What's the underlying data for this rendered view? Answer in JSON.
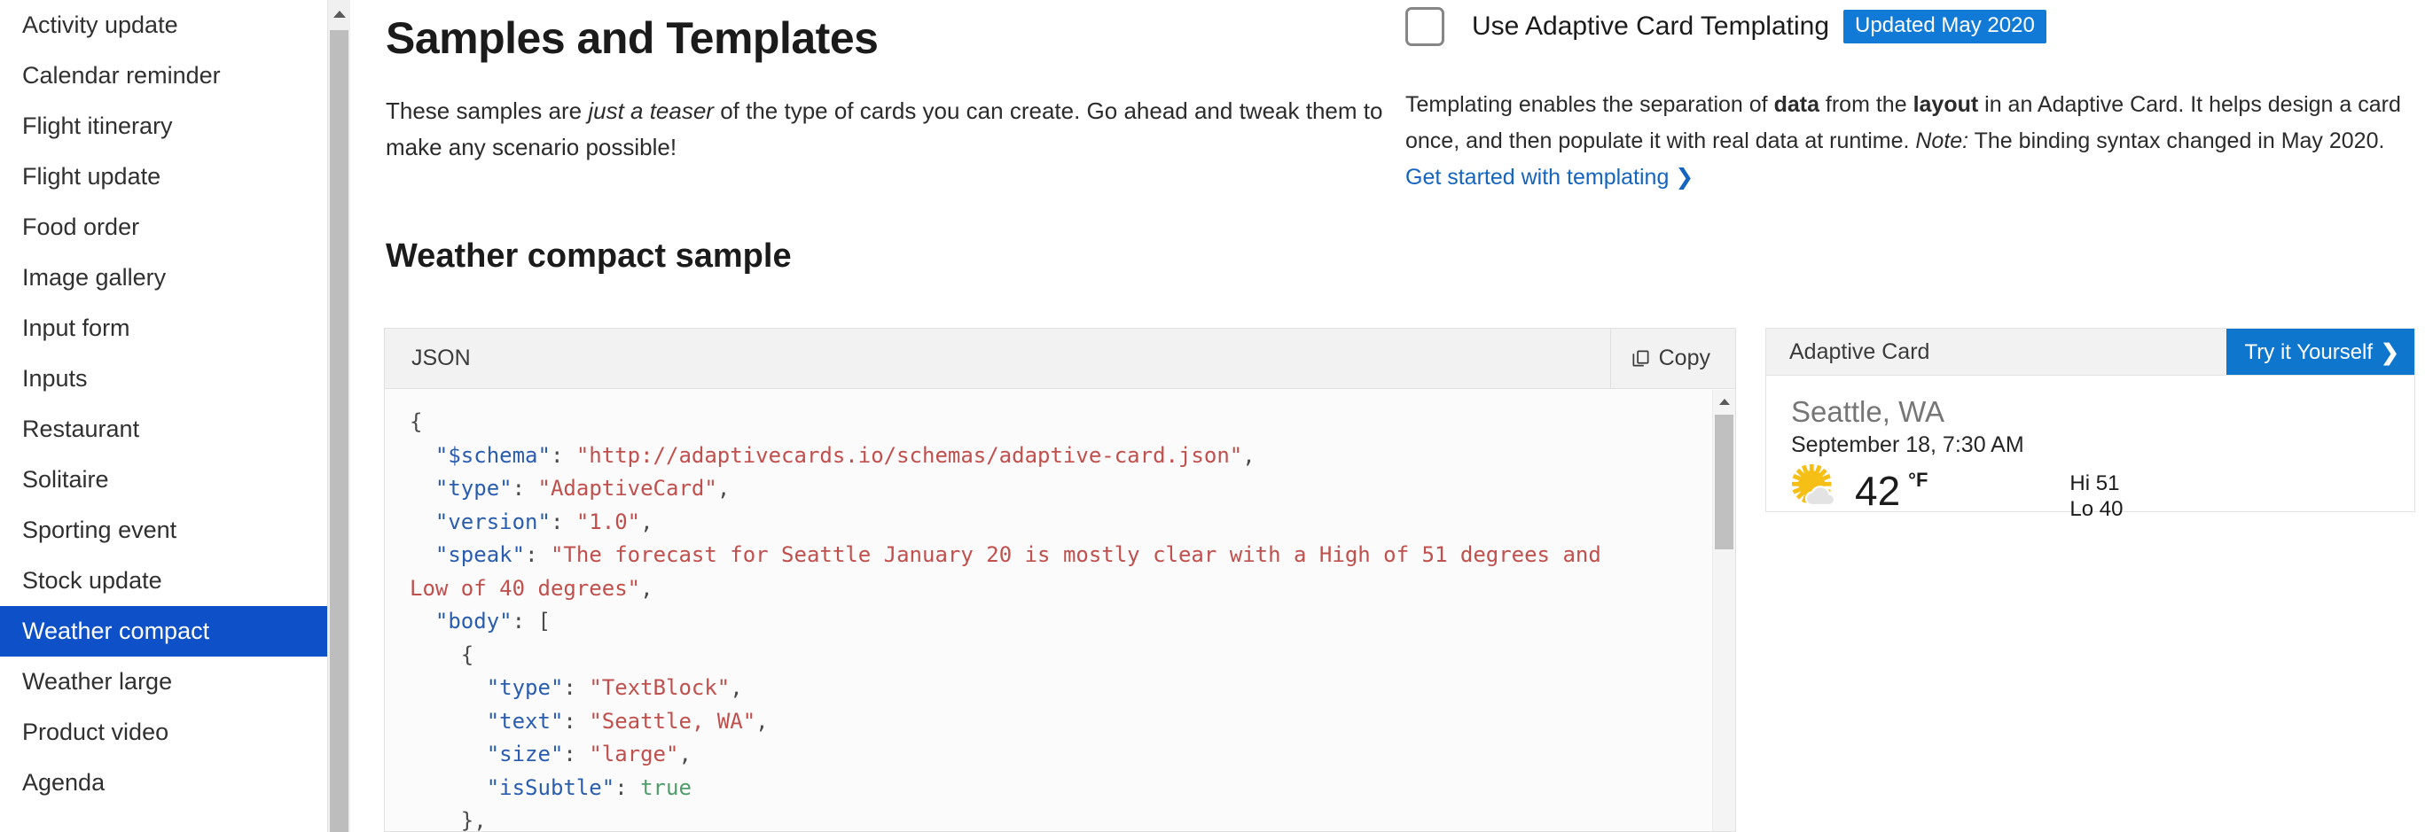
{
  "sidebar": {
    "items": [
      {
        "label": "Activity update",
        "selected": false
      },
      {
        "label": "Calendar reminder",
        "selected": false
      },
      {
        "label": "Flight itinerary",
        "selected": false
      },
      {
        "label": "Flight update",
        "selected": false
      },
      {
        "label": "Food order",
        "selected": false
      },
      {
        "label": "Image gallery",
        "selected": false
      },
      {
        "label": "Input form",
        "selected": false
      },
      {
        "label": "Inputs",
        "selected": false
      },
      {
        "label": "Restaurant",
        "selected": false
      },
      {
        "label": "Solitaire",
        "selected": false
      },
      {
        "label": "Sporting event",
        "selected": false
      },
      {
        "label": "Stock update",
        "selected": false
      },
      {
        "label": "Weather compact",
        "selected": true
      },
      {
        "label": "Weather large",
        "selected": false
      },
      {
        "label": "Product video",
        "selected": false
      },
      {
        "label": "Agenda",
        "selected": false
      }
    ],
    "scroll_up_icon": "chevron-up-icon"
  },
  "header": {
    "title": "Samples and Templates",
    "subtitle_part1": "These samples are ",
    "subtitle_italic": "just a teaser",
    "subtitle_part2": " of the type of cards you can create. Go ahead and tweak them to make any scenario possible!"
  },
  "templating": {
    "checkbox_checked": false,
    "label": "Use Adaptive Card Templating",
    "badge": "Updated May 2020",
    "badge_color": "#107ad6",
    "desc_part1": "Templating enables the separation of ",
    "desc_bold1": "data",
    "desc_part2": " from the ",
    "desc_bold2": "layout",
    "desc_part3": " in an Adaptive Card. It helps design a card once, and then populate it with real data at runtime. ",
    "desc_italic": "Note:",
    "desc_part4": " The binding syntax changed in May 2020. ",
    "link_text": "Get started with templating",
    "link_chevron": "❯",
    "link_color": "#1464c0"
  },
  "section": {
    "title": "Weather compact sample"
  },
  "code_panel": {
    "language_label": "JSON",
    "copy_label": "Copy",
    "copy_icon": "copy-icon",
    "scroll_up_icon": "chevron-up-icon",
    "lines": [
      {
        "indent": 0,
        "tokens": [
          {
            "t": "pun",
            "v": "{"
          }
        ]
      },
      {
        "indent": 1,
        "tokens": [
          {
            "t": "key",
            "v": "\"$schema\""
          },
          {
            "t": "pun",
            "v": ": "
          },
          {
            "t": "str",
            "v": "\"http://adaptivecards.io/schemas/adaptive-card.json\""
          },
          {
            "t": "pun",
            "v": ","
          }
        ]
      },
      {
        "indent": 1,
        "tokens": [
          {
            "t": "key",
            "v": "\"type\""
          },
          {
            "t": "pun",
            "v": ": "
          },
          {
            "t": "str",
            "v": "\"AdaptiveCard\""
          },
          {
            "t": "pun",
            "v": ","
          }
        ]
      },
      {
        "indent": 1,
        "tokens": [
          {
            "t": "key",
            "v": "\"version\""
          },
          {
            "t": "pun",
            "v": ": "
          },
          {
            "t": "str",
            "v": "\"1.0\""
          },
          {
            "t": "pun",
            "v": ","
          }
        ]
      },
      {
        "indent": 1,
        "tokens": [
          {
            "t": "key",
            "v": "\"speak\""
          },
          {
            "t": "pun",
            "v": ": "
          },
          {
            "t": "str",
            "v": "\"The forecast for Seattle January 20 is mostly clear with a High of 51 degrees and Low of 40 degrees\""
          },
          {
            "t": "pun",
            "v": ","
          }
        ]
      },
      {
        "indent": 1,
        "tokens": [
          {
            "t": "key",
            "v": "\"body\""
          },
          {
            "t": "pun",
            "v": ": ["
          }
        ]
      },
      {
        "indent": 2,
        "tokens": [
          {
            "t": "pun",
            "v": "{"
          }
        ]
      },
      {
        "indent": 3,
        "tokens": [
          {
            "t": "key",
            "v": "\"type\""
          },
          {
            "t": "pun",
            "v": ": "
          },
          {
            "t": "str",
            "v": "\"TextBlock\""
          },
          {
            "t": "pun",
            "v": ","
          }
        ]
      },
      {
        "indent": 3,
        "tokens": [
          {
            "t": "key",
            "v": "\"text\""
          },
          {
            "t": "pun",
            "v": ": "
          },
          {
            "t": "str",
            "v": "\"Seattle, WA\""
          },
          {
            "t": "pun",
            "v": ","
          }
        ]
      },
      {
        "indent": 3,
        "tokens": [
          {
            "t": "key",
            "v": "\"size\""
          },
          {
            "t": "pun",
            "v": ": "
          },
          {
            "t": "str",
            "v": "\"large\""
          },
          {
            "t": "pun",
            "v": ","
          }
        ]
      },
      {
        "indent": 3,
        "tokens": [
          {
            "t": "key",
            "v": "\"isSubtle\""
          },
          {
            "t": "pun",
            "v": ": "
          },
          {
            "t": "bool",
            "v": "true"
          }
        ]
      },
      {
        "indent": 2,
        "tokens": [
          {
            "t": "pun",
            "v": "},"
          }
        ]
      }
    ]
  },
  "preview_panel": {
    "header_label": "Adaptive Card",
    "try_it_label": "Try it Yourself",
    "try_it_chevron": "❯",
    "try_it_color": "#0f76ce",
    "card": {
      "city": "Seattle, WA",
      "datetime": "September 18, 7:30 AM",
      "weather_icon": "sun-behind-cloud-icon",
      "temperature": "42",
      "unit": "°F",
      "high": "Hi 51",
      "low": "Lo 40",
      "sun_color": "#f5bf16",
      "cloud_color": "#e3e3e3"
    }
  }
}
